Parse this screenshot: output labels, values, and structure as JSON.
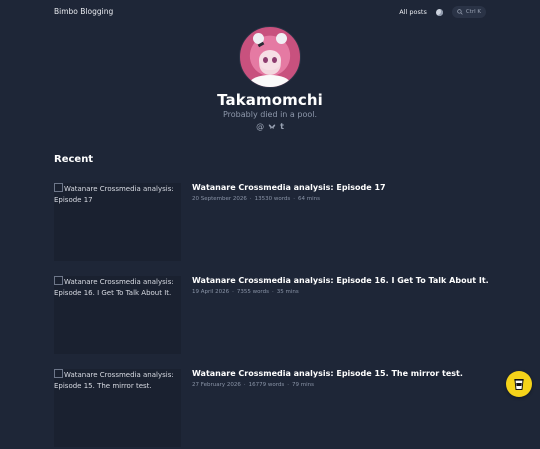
{
  "header": {
    "brand": "Bimbo Blogging",
    "nav_all_posts": "All posts",
    "search_shortcut": "Ctrl K"
  },
  "profile": {
    "name": "Takamomchi",
    "tagline": "Probably died in a pool.",
    "social_icons": [
      "at-icon",
      "bluesky-icon",
      "tumblr-icon"
    ]
  },
  "recent": {
    "heading": "Recent",
    "posts": [
      {
        "thumb_alt": "Watanare Crossmedia analysis: Episode 17",
        "title": "Watanare Crossmedia analysis: Episode 17",
        "date": "20 September 2026",
        "words": "13530 words",
        "read_time": "64 mins"
      },
      {
        "thumb_alt": "Watanare Crossmedia analysis: Episode 16. I Get To Talk About It.",
        "title": "Watanare Crossmedia analysis: Episode 16. I Get To Talk About It.",
        "date": "19 April 2026",
        "words": "7355 words",
        "read_time": "35 mins"
      },
      {
        "thumb_alt": "Watanare Crossmedia analysis: Episode 15. The mirror test.",
        "title": "Watanare Crossmedia analysis: Episode 15. The mirror test.",
        "date": "27 February 2026",
        "words": "16779 words",
        "read_time": "79 mins"
      }
    ]
  },
  "colors": {
    "background": "#1e2637",
    "accent_button": "#f5d31a"
  }
}
